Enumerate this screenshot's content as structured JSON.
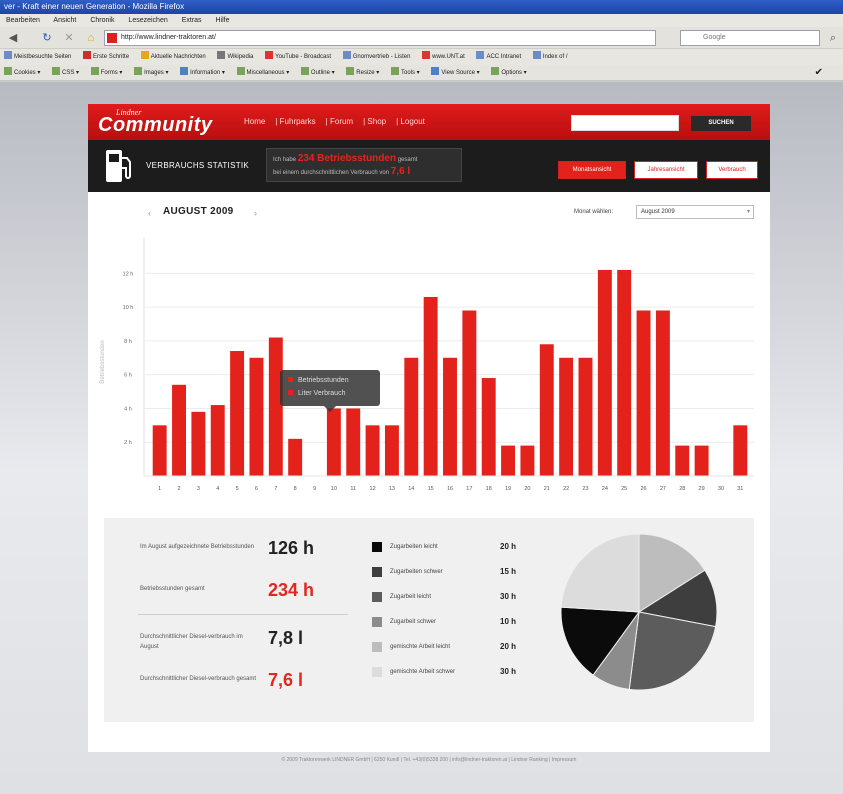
{
  "browser": {
    "title": "ver - Kraft einer neuen Generation - Mozilla Firefox",
    "menu": [
      "Bearbeiten",
      "Ansicht",
      "Chronik",
      "Lesezeichen",
      "Extras",
      "Hilfe"
    ],
    "url": "http://www.lindner-traktoren.at/",
    "search_placeholder": "Google",
    "bookmarks": [
      "Meistbesuchte Seiten",
      "Erste Schritte",
      "Aktuelle Nachrichten",
      "Wikipedia",
      "YouTube - Broadcast",
      "Gnomvertrieb - Listen",
      "www.UNT.at",
      "ACC Intranet",
      "Index of /"
    ],
    "toolbar": [
      "Cookies",
      "CSS",
      "Forms",
      "Images",
      "Information",
      "Miscellaneous",
      "Outline",
      "Resize",
      "Tools",
      "View Source",
      "Options"
    ]
  },
  "site": {
    "logo_top": "Lindner",
    "logo_main": "Community",
    "nav": [
      "Home",
      "Fuhrparks",
      "Forum",
      "Shop",
      "Logout"
    ],
    "search_button": "SUCHEN",
    "section_title": "VERBRAUCHS STATISTIK",
    "info_prefix": "Ich habe",
    "info_hours": "234 Betriebsstunden",
    "info_mid": "gesamt",
    "info_line2": "bei einem durchschnittlichen Verbrauch von",
    "info_consumption": "7,6 l",
    "tabs": [
      "Monatsansicht",
      "Jahresansicht",
      "Verbrauch"
    ],
    "month_label": "AUGUST 2009",
    "month_select_label": "Monat wählen:",
    "month_select_value": "August 2009",
    "tooltip": [
      "Betriebsstunden",
      "Liter Verbrauch"
    ],
    "footer": "© 2009 Traktorenwerk LINDNER GmbH | 6250 Kundl | Tel. +43(0)5338 200 | info@lindner-traktoren.at | Lindner Ranking | Impressum"
  },
  "chart_data": {
    "type": "bar",
    "categories": [
      "1",
      "2",
      "3",
      "4",
      "5",
      "6",
      "7",
      "8",
      "9",
      "10",
      "11",
      "12",
      "13",
      "14",
      "15",
      "16",
      "17",
      "18",
      "19",
      "20",
      "21",
      "22",
      "23",
      "24",
      "25",
      "26",
      "27",
      "28",
      "29",
      "30",
      "31"
    ],
    "values": [
      3,
      5.4,
      3.8,
      4.2,
      7.4,
      7,
      8.2,
      2.2,
      0,
      4,
      4,
      3,
      3,
      7,
      10.6,
      7,
      9.8,
      5.8,
      1.8,
      1.8,
      7.8,
      7,
      7,
      12.2,
      12.2,
      9.8,
      9.8,
      1.8,
      1.8,
      0,
      3
    ],
    "ytick_labels": [
      "2 h",
      "4 h",
      "6 h",
      "8 h",
      "10 h",
      "12 h"
    ],
    "ytick_values": [
      2,
      4,
      6,
      8,
      10,
      12
    ],
    "ylim": [
      0,
      13.5
    ],
    "ylabel": "Betriebsstunden",
    "bar_color": "#e3221c"
  },
  "stats": [
    {
      "label": "Im August aufgezeichnete Betriebsstunden",
      "value": "126 h",
      "red": false
    },
    {
      "label": "Betriebsstunden gesamt",
      "value": "234 h",
      "red": true
    },
    {
      "label": "Durchschnittlicher Diesel-verbrauch im August",
      "value": "7,8 l",
      "red": false
    },
    {
      "label": "Durchschnittlicher Diesel-verbrauch gesamt",
      "value": "7,6 l",
      "red": true
    }
  ],
  "pie": {
    "legend": [
      {
        "label": "Zugarbeiten leicht",
        "value": "20 h",
        "color": "#0b0b0b"
      },
      {
        "label": "Zugarbeiten schwer",
        "value": "15 h",
        "color": "#3e3e3e"
      },
      {
        "label": "Zugarbeit leicht",
        "value": "30 h",
        "color": "#5c5c5c"
      },
      {
        "label": "Zugarbeit schwer",
        "value": "10 h",
        "color": "#8c8c8c"
      },
      {
        "label": "gemischte Arbeit leicht",
        "value": "20 h",
        "color": "#bdbdbd"
      },
      {
        "label": "gemischte Arbeit schwer",
        "value": "30 h",
        "color": "#dcdcdc"
      }
    ],
    "slices": [
      {
        "name": "gemischte Arbeit leicht",
        "value": 20,
        "color": "#bdbdbd"
      },
      {
        "name": "Zugarbeiten schwer",
        "value": 15,
        "color": "#3e3e3e"
      },
      {
        "name": "Zugarbeit leicht",
        "value": 30,
        "color": "#5c5c5c"
      },
      {
        "name": "Zugarbeit schwer",
        "value": 10,
        "color": "#8c8c8c"
      },
      {
        "name": "Zugarbeiten leicht",
        "value": 20,
        "color": "#0b0b0b"
      },
      {
        "name": "gemischte Arbeit schwer",
        "value": 30,
        "color": "#dcdcdc"
      }
    ]
  }
}
